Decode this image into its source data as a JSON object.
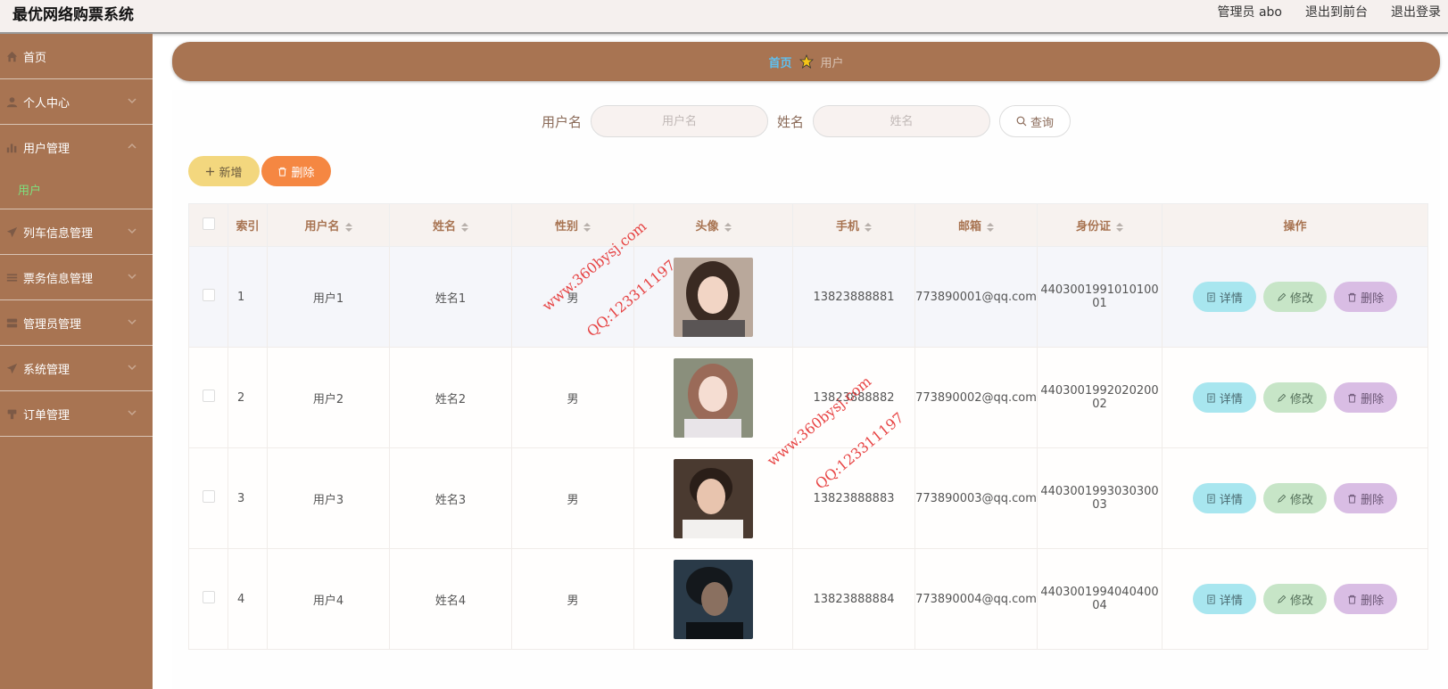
{
  "header": {
    "title": "最优网络购票系统",
    "admin_label": "管理员 abo",
    "to_front": "退出到前台",
    "logout": "退出登录"
  },
  "sidebar": {
    "items": [
      {
        "label": "首页",
        "icon": "home-icon"
      },
      {
        "label": "个人中心",
        "icon": "user-icon"
      },
      {
        "label": "用户管理",
        "icon": "bar-chart-icon",
        "sub": "用户"
      },
      {
        "label": "列车信息管理",
        "icon": "send-icon"
      },
      {
        "label": "票务信息管理",
        "icon": "sliders-icon"
      },
      {
        "label": "管理员管理",
        "icon": "database-icon"
      },
      {
        "label": "系统管理",
        "icon": "send-icon"
      },
      {
        "label": "订单管理",
        "icon": "bookmark-icon"
      }
    ]
  },
  "breadcrumb": {
    "home": "首页",
    "current": "用户"
  },
  "search": {
    "username_label": "用户名",
    "username_placeholder": "用户名",
    "name_label": "姓名",
    "name_placeholder": "姓名",
    "query_button": "查询"
  },
  "actions": {
    "add": "新增",
    "delete": "删除"
  },
  "table": {
    "headers": [
      "索引",
      "用户名",
      "姓名",
      "性别",
      "头像",
      "手机",
      "邮箱",
      "身份证",
      "操作"
    ],
    "op_labels": {
      "detail": "详情",
      "edit": "修改",
      "delete": "删除"
    },
    "rows": [
      {
        "index": "1",
        "username": "用户1",
        "name": "姓名1",
        "gender": "男",
        "phone": "13823888881",
        "email": "773890001@qq.com",
        "idcard": "440300199101010001"
      },
      {
        "index": "2",
        "username": "用户2",
        "name": "姓名2",
        "gender": "男",
        "phone": "13823888882",
        "email": "773890002@qq.com",
        "idcard": "440300199202020002"
      },
      {
        "index": "3",
        "username": "用户3",
        "name": "姓名3",
        "gender": "男",
        "phone": "13823888883",
        "email": "773890003@qq.com",
        "idcard": "440300199303030003"
      },
      {
        "index": "4",
        "username": "用户4",
        "name": "姓名4",
        "gender": "男",
        "phone": "13823888884",
        "email": "773890004@qq.com",
        "idcard": "440300199404040004"
      }
    ]
  },
  "watermark": {
    "line1": "www.360bysj.com",
    "line2": "QQ:123311197"
  },
  "colors": {
    "brand": "#a87452",
    "add": "#f3d77e",
    "delete": "#f58742",
    "detail": "#a8e6ef",
    "edit": "#c7e5c7",
    "remove": "#d9bde4"
  }
}
